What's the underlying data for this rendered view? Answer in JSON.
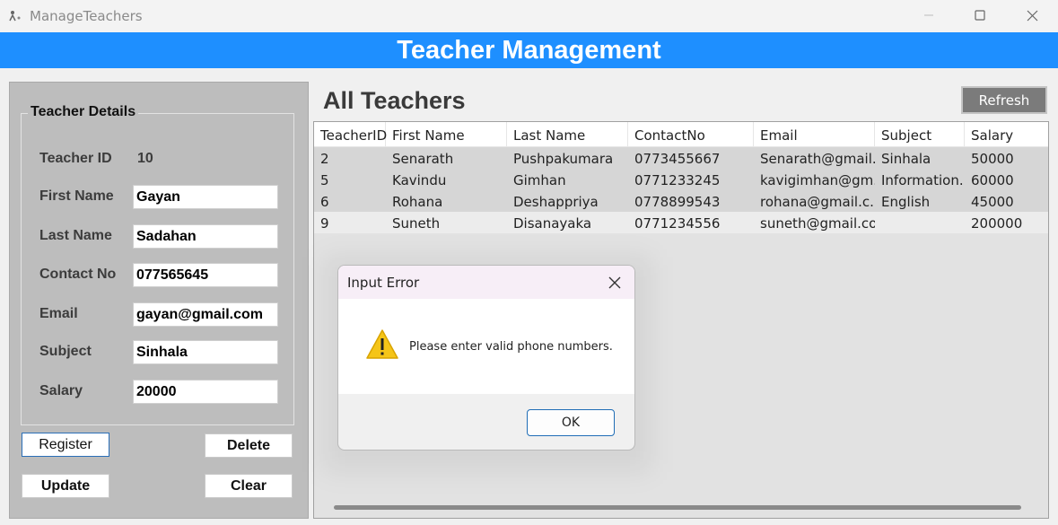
{
  "window": {
    "title": "ManageTeachers"
  },
  "banner": {
    "title": "Teacher Management"
  },
  "details": {
    "legend": "Teacher Details",
    "teacher_id_label": "Teacher ID",
    "teacher_id_value": "10",
    "first_name_label": "First Name",
    "first_name_value": "Gayan",
    "last_name_label": "Last Name",
    "last_name_value": "Sadahan",
    "contact_label": "Contact No",
    "contact_value": "077565645",
    "email_label": "Email",
    "email_value": "gayan@gmail.com",
    "subject_label": "Subject",
    "subject_value": "Sinhala",
    "salary_label": "Salary",
    "salary_value": "20000"
  },
  "buttons": {
    "register": "Register",
    "delete": "Delete",
    "update": "Update",
    "clear": "Clear"
  },
  "list": {
    "title": "All Teachers",
    "refresh": "Refresh",
    "columns": [
      "TeacherID",
      "First Name",
      "Last Name",
      "ContactNo",
      "Email",
      "Subject",
      "Salary"
    ],
    "rows": [
      [
        "2",
        "Senarath",
        "Pushpakumara",
        "0773455667",
        "Senarath@gmail....",
        "Sinhala",
        "50000"
      ],
      [
        "5",
        "Kavindu",
        "Gimhan",
        "0771233245",
        "kavigimhan@gm...",
        "Information...",
        "60000"
      ],
      [
        "6",
        "Rohana",
        "Deshappriya",
        "0778899543",
        "rohana@gmail.c...",
        "English",
        "45000"
      ],
      [
        "9",
        "Suneth",
        "Disanayaka",
        "0771234556",
        "suneth@gmail.co...",
        "",
        "200000"
      ]
    ]
  },
  "dialog": {
    "title": "Input Error",
    "message": "Please enter valid phone numbers.",
    "ok": "OK"
  },
  "colors": {
    "banner": "#1e8fff",
    "panel": "#bdbdbd",
    "refresh": "#7b7b7b",
    "warning": "#f5c518"
  }
}
